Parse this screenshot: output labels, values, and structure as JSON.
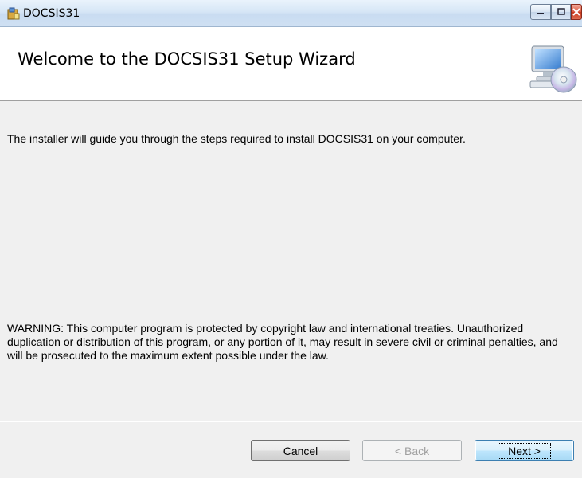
{
  "window": {
    "title": "DOCSIS31",
    "controls": {
      "minimize": "minimize",
      "maximize": "maximize",
      "close": "close"
    }
  },
  "banner": {
    "title": "Welcome to the DOCSIS31 Setup Wizard"
  },
  "content": {
    "intro": "The installer will guide you through the steps required to install DOCSIS31 on your computer.",
    "warning": "WARNING: This computer program is protected by copyright law and international treaties. Unauthorized duplication or distribution of this program, or any portion of it, may result in severe civil or criminal penalties, and will be prosecuted to the maximum extent possible under the law."
  },
  "buttons": {
    "cancel": "Cancel",
    "back_prefix": "< ",
    "back_accel": "B",
    "back_rest": "ack",
    "next_accel": "N",
    "next_rest": "ext >"
  },
  "colors": {
    "accent": "#3c7fb1",
    "close_button": "#c7371c"
  },
  "icons": {
    "app": "installer-icon",
    "banner": "computer-cd-icon"
  }
}
